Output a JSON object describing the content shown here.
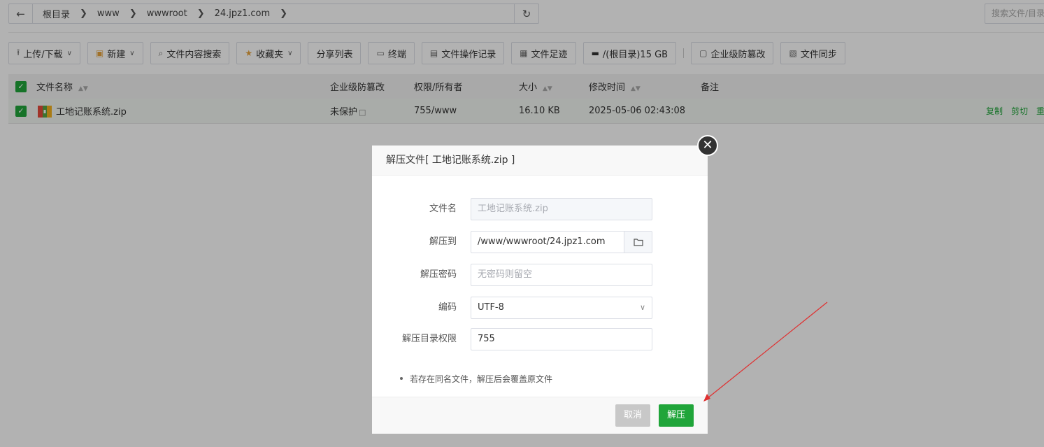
{
  "pathbar": {
    "crumbs": [
      "根目录",
      "www",
      "wwwroot",
      "24.jpz1.com"
    ],
    "search_placeholder": "搜索文件/目录"
  },
  "toolbar": {
    "upload": "上传/下载",
    "new": "新建",
    "content_search": "文件内容搜索",
    "favorites": "收藏夹",
    "share_list": "分享列表",
    "terminal": "终端",
    "op_log": "文件操作记录",
    "footprint": "文件足迹",
    "disk": "/(根目录)15 GB",
    "tamper": "企业级防篡改",
    "sync": "文件同步"
  },
  "table": {
    "headers": {
      "name": "文件名称",
      "tamper": "企业级防篡改",
      "perm": "权限/所有者",
      "size": "大小",
      "mtime": "修改时间",
      "remark": "备注"
    },
    "rows": [
      {
        "name": "工地记账系统.zip",
        "tamper": "未保护",
        "perm": "755/www",
        "size": "16.10 KB",
        "mtime": "2025-05-06 02:43:08",
        "actions": [
          "复制",
          "剪切",
          "重命名"
        ]
      }
    ]
  },
  "dialog": {
    "title": "解压文件[ 工地记账系统.zip ]",
    "fields": {
      "filename_label": "文件名",
      "filename_value": "工地记账系统.zip",
      "dest_label": "解压到",
      "dest_value": "/www/wwwroot/24.jpz1.com",
      "password_label": "解压密码",
      "password_placeholder": "无密码则留空",
      "encoding_label": "编码",
      "encoding_value": "UTF-8",
      "perm_label": "解压目录权限",
      "perm_value": "755"
    },
    "note": "若存在同名文件，解压后会覆盖原文件",
    "cancel": "取消",
    "confirm": "解压"
  },
  "colors": {
    "accent": "#20a53a",
    "arrow": "#e03030"
  }
}
